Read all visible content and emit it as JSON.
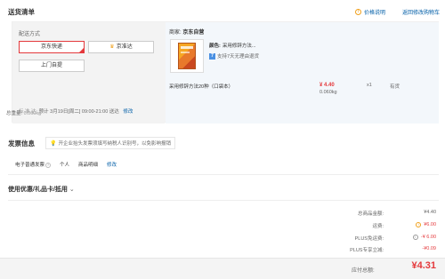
{
  "header": {
    "title": "送货清单",
    "price_notice": "价格说明",
    "back_to_cart": "返回修改购物车"
  },
  "shipping": {
    "label": "配送方式",
    "options": [
      "京东快递",
      "京准达",
      "上门自提"
    ],
    "selected": "京东快递",
    "time_label": "标 准 达:",
    "time_value": "预计 3月19日[周二] 09:00-21:00 送达",
    "modify": "修改",
    "total_weight_label": "总重量:",
    "total_weight_value": "0.060kg"
  },
  "item": {
    "seller_label": "商家:",
    "seller_name": "京东自营",
    "color_label": "颜色:",
    "color_value": "采用修辞方法...",
    "return_badge": "7",
    "return_text": "支持7天无理由退货",
    "name": "采用修辞方法20种（口袋本）",
    "price": "¥ 4.40",
    "weight": "0.060kg",
    "quantity": "x1",
    "stock": "有货"
  },
  "invoice": {
    "title": "发票信息",
    "tip": "开企业抬头发票须填写纳税人识别号，以免影响报销",
    "type": "电子普通发票",
    "header": "个人",
    "content": "商品明细",
    "modify": "修改"
  },
  "coupon": {
    "title": "使用优惠/礼品卡/抵用"
  },
  "summary": {
    "rows": [
      {
        "label": "总商品金额:",
        "value": "¥4.40",
        "color": "#666666",
        "info": false
      },
      {
        "label": "运费:",
        "value": "¥6.00",
        "color": "#e4393c",
        "info": true,
        "info_color": "#f0a11d"
      },
      {
        "label": "PLUS免运费:",
        "value": "-¥ 6.00",
        "color": "#e4393c",
        "info": true,
        "info_color": "#999999"
      },
      {
        "label": "PLUS专享立减:",
        "value": "-¥0.09",
        "color": "#e4393c",
        "info": false
      }
    ],
    "total_label": "应付总额:",
    "total_value": "¥4.31"
  }
}
